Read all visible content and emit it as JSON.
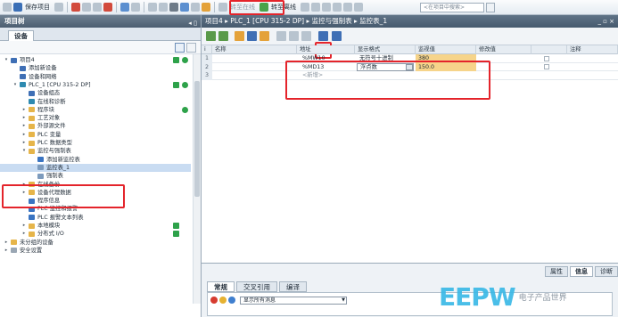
{
  "toolbar": {
    "save_project": "保存项目",
    "go_online": "转至在线",
    "go_offline": "转至离线",
    "search_placeholder": "<在项目中搜索>"
  },
  "project_tree": {
    "title": "项目树",
    "tab_devices": "设备",
    "items": [
      {
        "label": "项目4",
        "level": 0,
        "expand": "▾",
        "icon": "project-icon",
        "check": true,
        "dot": true
      },
      {
        "label": "添加新设备",
        "level": 1,
        "expand": "",
        "icon": "add-device-icon"
      },
      {
        "label": "设备和网络",
        "level": 1,
        "expand": "",
        "icon": "network-icon"
      },
      {
        "label": "PLC_1 [CPU 315-2 DP]",
        "level": 1,
        "expand": "▾",
        "icon": "cpu-icon",
        "check": true,
        "dot": true
      },
      {
        "label": "设备组态",
        "level": 2,
        "expand": "",
        "icon": "device-config-icon"
      },
      {
        "label": "在线和诊断",
        "level": 2,
        "expand": "",
        "icon": "diagnostics-icon"
      },
      {
        "label": "程序块",
        "level": 2,
        "expand": "▸",
        "icon": "folder-icon",
        "dot": true
      },
      {
        "label": "工艺对象",
        "level": 2,
        "expand": "▸",
        "icon": "folder-icon"
      },
      {
        "label": "外部源文件",
        "level": 2,
        "expand": "▸",
        "icon": "folder-icon"
      },
      {
        "label": "PLC 变量",
        "level": 2,
        "expand": "▸",
        "icon": "folder-icon"
      },
      {
        "label": "PLC 数据类型",
        "level": 2,
        "expand": "▸",
        "icon": "folder-icon"
      },
      {
        "label": "监控与强制表",
        "level": 2,
        "expand": "▾",
        "icon": "folder-icon"
      },
      {
        "label": "添加新监控表",
        "level": 3,
        "expand": "",
        "icon": "add-watch-table-icon"
      },
      {
        "label": "监控表_1",
        "level": 3,
        "expand": "",
        "icon": "watch-table-icon",
        "selected": true
      },
      {
        "label": "强制表",
        "level": 3,
        "expand": "",
        "icon": "force-table-icon"
      },
      {
        "label": "在线备份",
        "level": 2,
        "expand": "▸",
        "icon": "folder-icon"
      },
      {
        "label": "设备代理数据",
        "level": 2,
        "expand": "▸",
        "icon": "folder-icon"
      },
      {
        "label": "程序信息",
        "level": 2,
        "expand": "",
        "icon": "program-info-icon"
      },
      {
        "label": "PLC 监控和报警",
        "level": 2,
        "expand": "",
        "icon": "alarm-icon"
      },
      {
        "label": "PLC 报警文本列表",
        "level": 2,
        "expand": "",
        "icon": "text-list-icon"
      },
      {
        "label": "本地模块",
        "level": 2,
        "expand": "▸",
        "icon": "folder-icon",
        "check": true
      },
      {
        "label": "分布式 I/O",
        "level": 2,
        "expand": "▸",
        "icon": "folder-icon",
        "check": true
      },
      {
        "label": "未分组的设备",
        "level": 0,
        "expand": "▸",
        "icon": "folder-icon"
      },
      {
        "label": "安全设置",
        "level": 0,
        "expand": "▸",
        "icon": "security-icon"
      }
    ]
  },
  "editor": {
    "breadcrumb": "项目4 ▸ PLC_1 [CPU 315-2 DP] ▸ 监控与强制表 ▸ 监控表_1",
    "columns": [
      "i",
      "名称",
      "地址",
      "显示格式",
      "监视值",
      "修改值",
      "",
      "注释"
    ],
    "rows": [
      {
        "num": "1",
        "name": "",
        "address": "%MW10",
        "format": "无符号十进制",
        "monitor": "380"
      },
      {
        "num": "2",
        "name": "",
        "address": "%MD13",
        "format": "浮点数",
        "monitor": "150.0"
      },
      {
        "num": "3",
        "name": "",
        "address": "<新增>",
        "format": "",
        "monitor": ""
      }
    ]
  },
  "inspector": {
    "right_tabs": [
      "属性",
      "信息",
      "诊断"
    ],
    "tabs": [
      "常规",
      "交叉引用",
      "编译"
    ],
    "filter": "显示所有消息"
  },
  "watermark": {
    "logo": "EEPW",
    "sub": "电子产品世界"
  }
}
